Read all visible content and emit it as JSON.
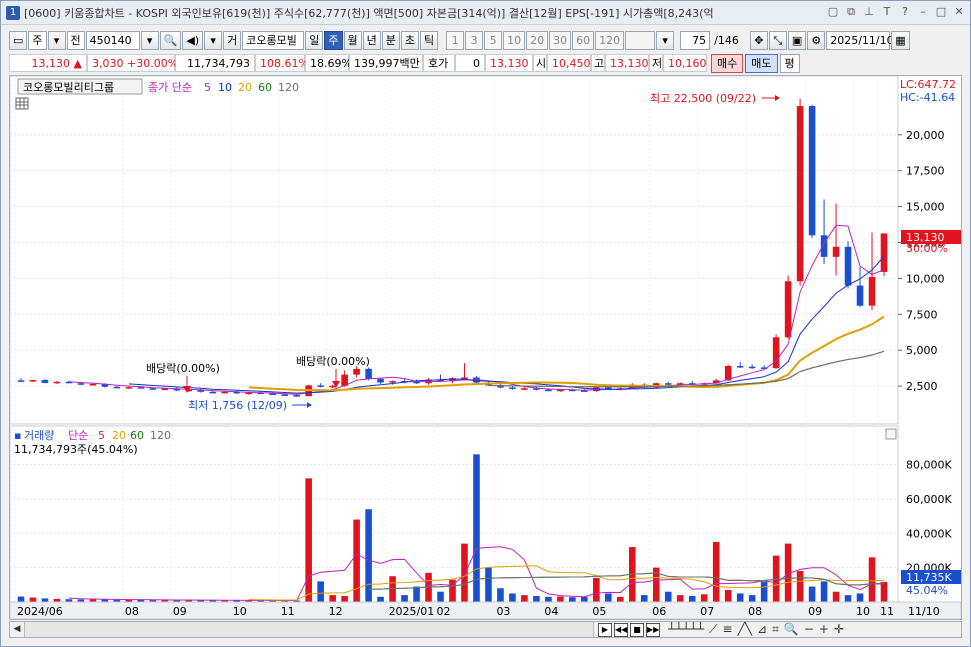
{
  "window": {
    "badge": "1",
    "title": "[0600] 키움종합차트 - KOSPI 외국인보유[619(천)] 주식수[62,777(천)] 액면[500] 자본금[314(억)] 결산[12월] EPS[-191] 시가총액[8,243(억"
  },
  "toolbar": {
    "type_label": "주",
    "all_label": "전",
    "code": "450140",
    "trade_label": "거",
    "stock_name": "코오롱모빌",
    "periods": [
      "일",
      "주",
      "월",
      "년",
      "분",
      "초",
      "틱"
    ],
    "active_period": "주",
    "numbers": [
      "1",
      "3",
      "5",
      "10",
      "20",
      "30",
      "60",
      "120"
    ],
    "count": "75",
    "total": "/146",
    "date": "2025/11/10"
  },
  "quote": {
    "price": "13,130",
    "change": "3,030",
    "change_pct": "+30.00%",
    "volume": "11,734,793",
    "vol_ratio": "108.61%",
    "turnover": "18.69%",
    "amount": "139,997백만",
    "hoga_label": "호가",
    "hoga_value": "0",
    "hoga_price": "13,130",
    "open_label": "시",
    "open": "10,450",
    "high_label": "고",
    "high": "13,130",
    "low_label": "저",
    "low": "10,160",
    "buy_label": "매수",
    "sell_label": "매도",
    "avg_label": "평"
  },
  "price_panel": {
    "stock_label": "코오롱모빌리티그룹",
    "ma_label": "종가 단순",
    "ma_periods": [
      "5",
      "10",
      "20",
      "60",
      "120"
    ],
    "ma_colors": [
      "#c020c0",
      "#1030d0",
      "#e0a000",
      "#108010",
      "#707070"
    ],
    "lc": "LC:647.72",
    "hc": "HC:-41.64",
    "annot_high": "최고 22,500 (09/22)",
    "annot_low": "최저 1,756 (12/09)",
    "annot_div1": "배당락(0.00%)",
    "annot_div2": "배당락(0.00%)",
    "y_ticks": [
      "20,000",
      "17,500",
      "15,000",
      "12,500",
      "10,000",
      "7,500",
      "5,000",
      "2,500"
    ],
    "current_price": "13,130",
    "current_pct": "30.00%"
  },
  "volume_panel": {
    "label": "거래량",
    "ma_label": "단순",
    "ma_periods": [
      "5",
      "20",
      "60",
      "120"
    ],
    "ma_colors": [
      "#c020c0",
      "#e0a000",
      "#108010",
      "#707070"
    ],
    "value_text": "11,734,793주(45.04%)",
    "y_ticks": [
      "80,000K",
      "60,000K",
      "40,000K",
      "20,000K"
    ],
    "current_vol": "11,735K",
    "current_pct": "45.04%"
  },
  "x_axis": {
    "labels": [
      "2024/06",
      "08",
      "09",
      "10",
      "11",
      "12",
      "2025/01",
      "02",
      "03",
      "04",
      "05",
      "06",
      "07",
      "08",
      "09",
      "10",
      "11"
    ],
    "right_label": "11/10"
  },
  "chart_data": {
    "type": "candlestick",
    "x_unit": "week",
    "y_unit": "KRW",
    "ylim": [
      0,
      22500
    ],
    "candles": [
      {
        "open": 2900,
        "high": 3050,
        "low": 2820,
        "close": 2840
      },
      {
        "open": 2840,
        "high": 2950,
        "low": 2780,
        "close": 2920
      },
      {
        "open": 2920,
        "high": 2990,
        "low": 2700,
        "close": 2720
      },
      {
        "open": 2720,
        "high": 2850,
        "low": 2650,
        "close": 2800
      },
      {
        "open": 2800,
        "high": 2880,
        "low": 2680,
        "close": 2700
      },
      {
        "open": 2700,
        "high": 2760,
        "low": 2560,
        "close": 2600
      },
      {
        "open": 2600,
        "high": 2700,
        "low": 2520,
        "close": 2650
      },
      {
        "open": 2650,
        "high": 2700,
        "low": 2400,
        "close": 2450
      },
      {
        "open": 2450,
        "high": 2520,
        "low": 2350,
        "close": 2400
      },
      {
        "open": 2400,
        "high": 2480,
        "low": 2300,
        "close": 2430
      },
      {
        "open": 2430,
        "high": 2500,
        "low": 2320,
        "close": 2350
      },
      {
        "open": 2350,
        "high": 2420,
        "low": 2250,
        "close": 2300
      },
      {
        "open": 2300,
        "high": 2380,
        "low": 2200,
        "close": 2330
      },
      {
        "open": 2330,
        "high": 2400,
        "low": 2150,
        "close": 2200
      },
      {
        "open": 2200,
        "high": 2300,
        "low": 2100,
        "close": 2250
      },
      {
        "open": 2250,
        "high": 2300,
        "low": 2050,
        "close": 2100
      },
      {
        "open": 2100,
        "high": 2180,
        "low": 2000,
        "close": 2050
      },
      {
        "open": 2050,
        "high": 2150,
        "low": 1980,
        "close": 2100
      },
      {
        "open": 2100,
        "high": 2180,
        "low": 1950,
        "close": 2000
      },
      {
        "open": 2000,
        "high": 2100,
        "low": 1900,
        "close": 2050
      },
      {
        "open": 2050,
        "high": 2120,
        "low": 1950,
        "close": 1980
      },
      {
        "open": 1980,
        "high": 2050,
        "low": 1880,
        "close": 1920
      },
      {
        "open": 1920,
        "high": 2000,
        "low": 1820,
        "close": 1880
      },
      {
        "open": 1880,
        "high": 1950,
        "low": 1756,
        "close": 1800
      },
      {
        "open": 1800,
        "high": 2600,
        "low": 1790,
        "close": 2550
      },
      {
        "open": 2550,
        "high": 2700,
        "low": 2400,
        "close": 2480
      },
      {
        "open": 2480,
        "high": 2600,
        "low": 2350,
        "close": 2520
      },
      {
        "open": 2520,
        "high": 3600,
        "low": 2450,
        "close": 3300
      },
      {
        "open": 3300,
        "high": 3900,
        "low": 3100,
        "close": 3700
      },
      {
        "open": 3700,
        "high": 3800,
        "low": 2900,
        "close": 3000
      },
      {
        "open": 3000,
        "high": 3100,
        "low": 2650,
        "close": 2750
      },
      {
        "open": 2750,
        "high": 2900,
        "low": 2600,
        "close": 2850
      },
      {
        "open": 2850,
        "high": 3000,
        "low": 2700,
        "close": 2800
      },
      {
        "open": 2800,
        "high": 2950,
        "low": 2650,
        "close": 2700
      },
      {
        "open": 2700,
        "high": 3050,
        "low": 2600,
        "close": 2950
      },
      {
        "open": 2950,
        "high": 3300,
        "low": 2800,
        "close": 2850
      },
      {
        "open": 2850,
        "high": 3100,
        "low": 2700,
        "close": 3050
      },
      {
        "open": 3050,
        "high": 4100,
        "low": 2900,
        "close": 3100
      },
      {
        "open": 3100,
        "high": 3200,
        "low": 2700,
        "close": 2750
      },
      {
        "open": 2750,
        "high": 2850,
        "low": 2500,
        "close": 2550
      },
      {
        "open": 2550,
        "high": 2650,
        "low": 2350,
        "close": 2400
      },
      {
        "open": 2400,
        "high": 2500,
        "low": 2250,
        "close": 2300
      },
      {
        "open": 2300,
        "high": 2420,
        "low": 2200,
        "close": 2350
      },
      {
        "open": 2350,
        "high": 2450,
        "low": 2200,
        "close": 2250
      },
      {
        "open": 2250,
        "high": 2350,
        "low": 2150,
        "close": 2200
      },
      {
        "open": 2200,
        "high": 2300,
        "low": 2100,
        "close": 2250
      },
      {
        "open": 2250,
        "high": 2330,
        "low": 2150,
        "close": 2200
      },
      {
        "open": 2200,
        "high": 2280,
        "low": 2100,
        "close": 2150
      },
      {
        "open": 2150,
        "high": 2450,
        "low": 2100,
        "close": 2400
      },
      {
        "open": 2400,
        "high": 2500,
        "low": 2250,
        "close": 2300
      },
      {
        "open": 2300,
        "high": 2400,
        "low": 2200,
        "close": 2350
      },
      {
        "open": 2350,
        "high": 2700,
        "low": 2300,
        "close": 2600
      },
      {
        "open": 2600,
        "high": 2700,
        "low": 2350,
        "close": 2400
      },
      {
        "open": 2400,
        "high": 2750,
        "low": 2350,
        "close": 2700
      },
      {
        "open": 2700,
        "high": 2800,
        "low": 2550,
        "close": 2600
      },
      {
        "open": 2600,
        "high": 2750,
        "low": 2500,
        "close": 2700
      },
      {
        "open": 2700,
        "high": 2850,
        "low": 2600,
        "close": 2650
      },
      {
        "open": 2650,
        "high": 2750,
        "low": 2550,
        "close": 2700
      },
      {
        "open": 2700,
        "high": 3000,
        "low": 2650,
        "close": 2900
      },
      {
        "open": 2900,
        "high": 4000,
        "low": 2850,
        "close": 3900
      },
      {
        "open": 3900,
        "high": 4200,
        "low": 3750,
        "close": 3850
      },
      {
        "open": 3850,
        "high": 4000,
        "low": 3700,
        "close": 3800
      },
      {
        "open": 3800,
        "high": 3950,
        "low": 3650,
        "close": 3750
      },
      {
        "open": 3750,
        "high": 6100,
        "low": 3700,
        "close": 5900
      },
      {
        "open": 5900,
        "high": 10200,
        "low": 5800,
        "close": 9800
      },
      {
        "open": 9800,
        "high": 22500,
        "low": 9500,
        "close": 22000
      },
      {
        "open": 22000,
        "high": 22100,
        "low": 12800,
        "close": 13000
      },
      {
        "open": 13000,
        "high": 15500,
        "low": 11000,
        "close": 11500
      },
      {
        "open": 11500,
        "high": 15200,
        "low": 10200,
        "close": 12200
      },
      {
        "open": 12200,
        "high": 12600,
        "low": 9300,
        "close": 9500
      },
      {
        "open": 9500,
        "high": 10800,
        "low": 8000,
        "close": 8100
      },
      {
        "open": 8100,
        "high": 13200,
        "low": 7800,
        "close": 10100
      },
      {
        "open": 10450,
        "high": 13130,
        "low": 10160,
        "close": 13130
      }
    ],
    "volume_k": [
      3200,
      2600,
      2100,
      1800,
      1600,
      1500,
      1700,
      1400,
      1300,
      1200,
      1300,
      1100,
      1200,
      1150,
      1100,
      1000,
      950,
      1000,
      900,
      950,
      850,
      900,
      800,
      850,
      72000,
      12000,
      4000,
      3500,
      48000,
      54000,
      3000,
      15000,
      4000,
      9000,
      17000,
      6000,
      13000,
      34000,
      86000,
      20000,
      8000,
      5000,
      4000,
      3500,
      3000,
      3200,
      2800,
      3000,
      14000,
      5000,
      3000,
      32000,
      4000,
      20000,
      6000,
      4000,
      3500,
      4500,
      35000,
      7000,
      5000,
      4000,
      12000,
      27000,
      34000,
      18000,
      9000,
      12000,
      6000,
      4000,
      5000,
      26000,
      11735
    ]
  }
}
